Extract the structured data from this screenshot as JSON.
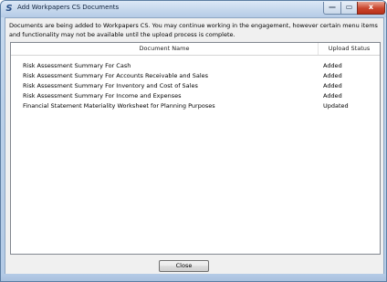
{
  "window": {
    "title": "Add Workpapers CS Documents",
    "icon": "S",
    "controls": {
      "minimize": "—",
      "maximize": "▭",
      "close": "x"
    }
  },
  "message": "Documents are being added to Workpapers CS.  You may continue working in the engagement, however certain menu items and functionality may not be available  until the upload process is complete.",
  "table": {
    "columns": [
      "Document Name",
      "Upload Status"
    ],
    "rows": [
      {
        "name": "Risk  Assessment  Summary  For  Cash",
        "status": "Added"
      },
      {
        "name": "Risk  Assessment  Summary  For  Accounts  Receivable  and  Sales",
        "status": "Added"
      },
      {
        "name": "Risk  Assessment  Summary  For  Inventory  and  Cost  of  Sales",
        "status": "Added"
      },
      {
        "name": "Risk  Assessment  Summary  For  Income  and  Expenses",
        "status": "Added"
      },
      {
        "name": "Financial  Statement  Materiality  Worksheet  for  Planning  Purposes",
        "status": "Updated"
      }
    ]
  },
  "buttons": {
    "close": "Close"
  }
}
